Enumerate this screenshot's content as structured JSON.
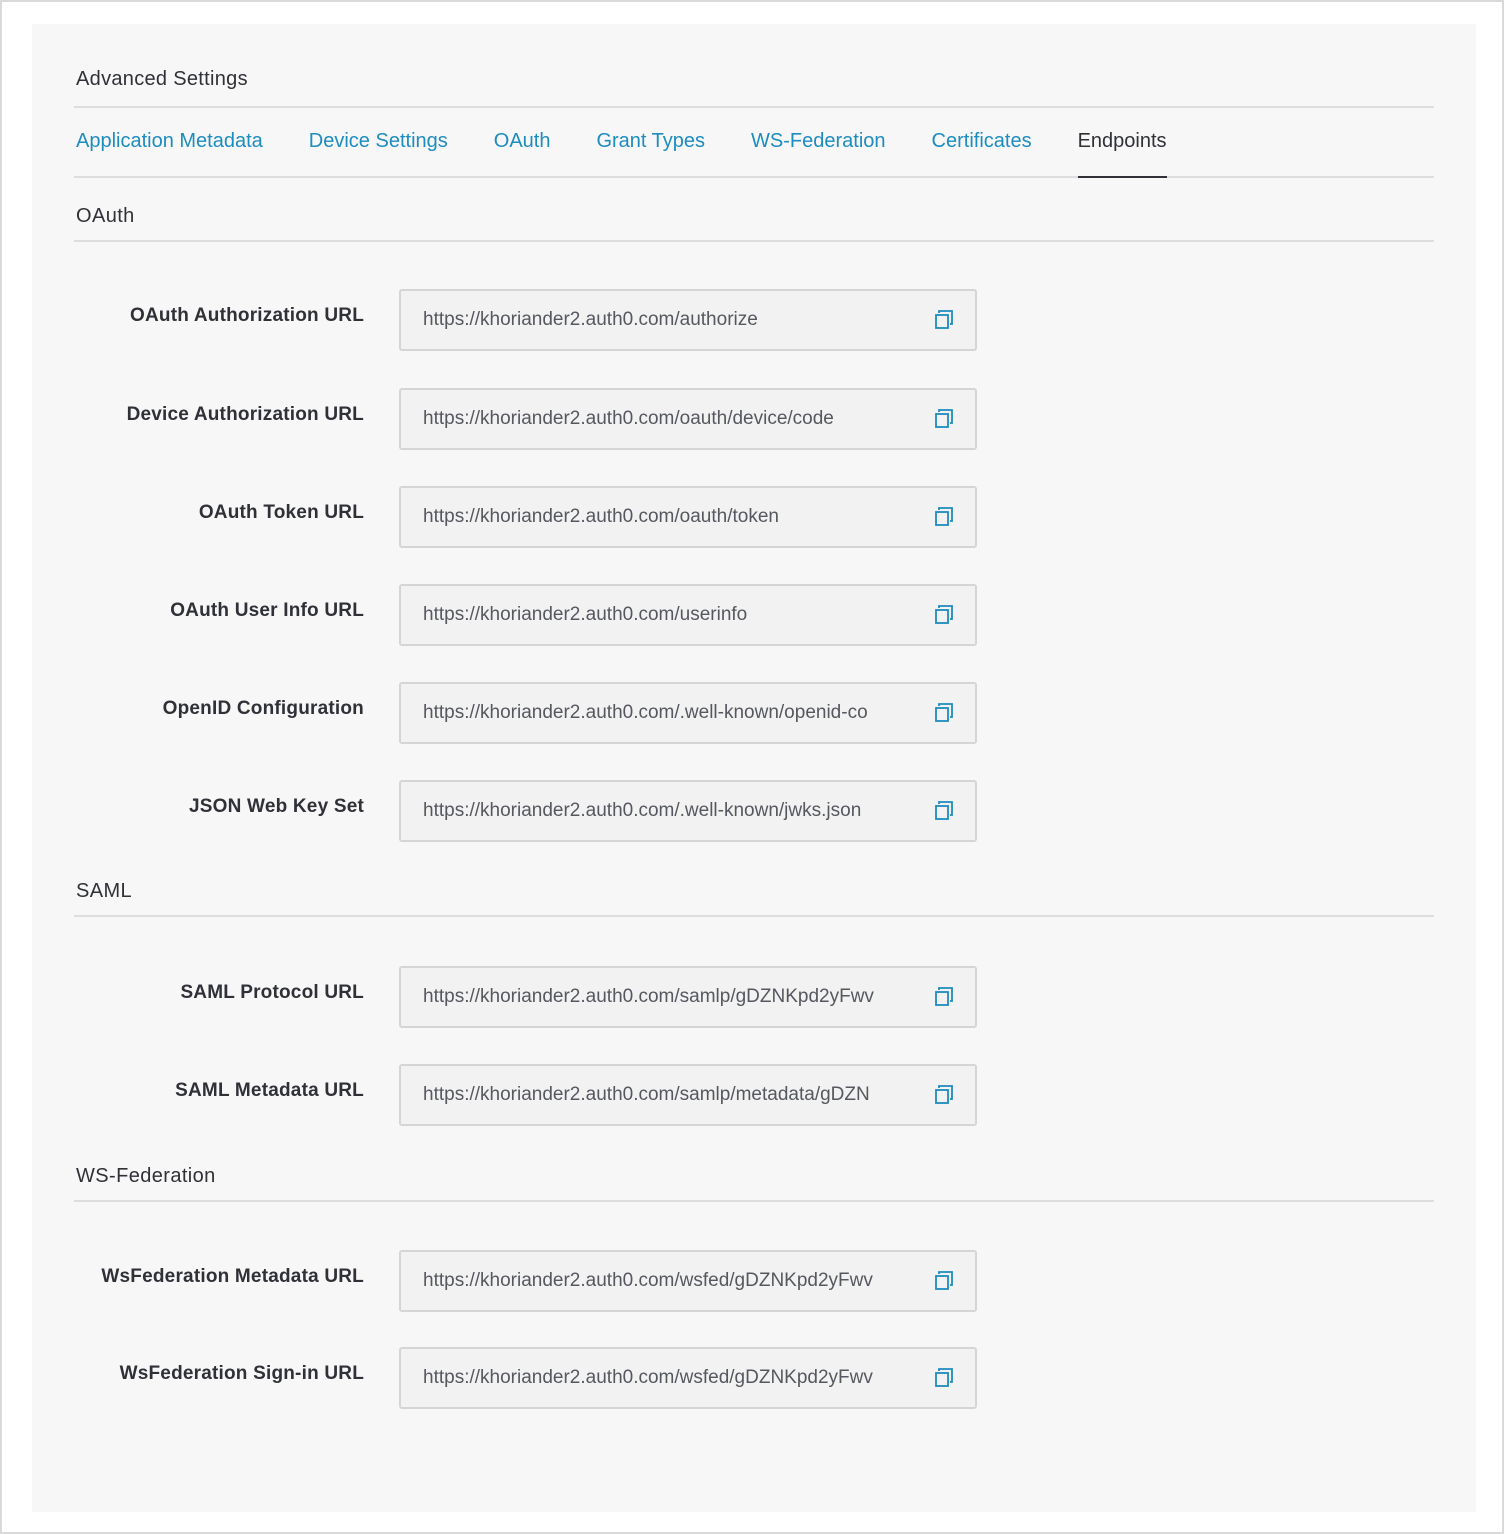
{
  "title": "Advanced Settings",
  "tabs": [
    {
      "label": "Application Metadata",
      "active": false
    },
    {
      "label": "Device Settings",
      "active": false
    },
    {
      "label": "OAuth",
      "active": false
    },
    {
      "label": "Grant Types",
      "active": false
    },
    {
      "label": "WS-Federation",
      "active": false
    },
    {
      "label": "Certificates",
      "active": false
    },
    {
      "label": "Endpoints",
      "active": true
    }
  ],
  "sections": {
    "oauth": {
      "heading": "OAuth",
      "fields": [
        {
          "label": "OAuth Authorization URL",
          "value": "https://khoriander2.auth0.com/authorize"
        },
        {
          "label": "Device Authorization URL",
          "value": "https://khoriander2.auth0.com/oauth/device/code"
        },
        {
          "label": "OAuth Token URL",
          "value": "https://khoriander2.auth0.com/oauth/token"
        },
        {
          "label": "OAuth User Info URL",
          "value": "https://khoriander2.auth0.com/userinfo"
        },
        {
          "label": "OpenID Configuration",
          "value": "https://khoriander2.auth0.com/.well-known/openid-co"
        },
        {
          "label": "JSON Web Key Set",
          "value": "https://khoriander2.auth0.com/.well-known/jwks.json"
        }
      ]
    },
    "saml": {
      "heading": "SAML",
      "fields": [
        {
          "label": "SAML Protocol URL",
          "value": "https://khoriander2.auth0.com/samlp/gDZNKpd2yFwv"
        },
        {
          "label": "SAML Metadata URL",
          "value": "https://khoriander2.auth0.com/samlp/metadata/gDZN"
        }
      ]
    },
    "wsfed": {
      "heading": "WS-Federation",
      "fields": [
        {
          "label": "WsFederation Metadata URL",
          "value": "https://khoriander2.auth0.com/wsfed/gDZNKpd2yFwv"
        },
        {
          "label": "WsFederation Sign-in URL",
          "value": "https://khoriander2.auth0.com/wsfed/gDZNKpd2yFwv"
        }
      ]
    }
  },
  "icons": {
    "copy": "copy-icon"
  },
  "colors": {
    "link": "#1d8cbf",
    "text": "#2f3137",
    "icon": "#1d8cbf"
  }
}
